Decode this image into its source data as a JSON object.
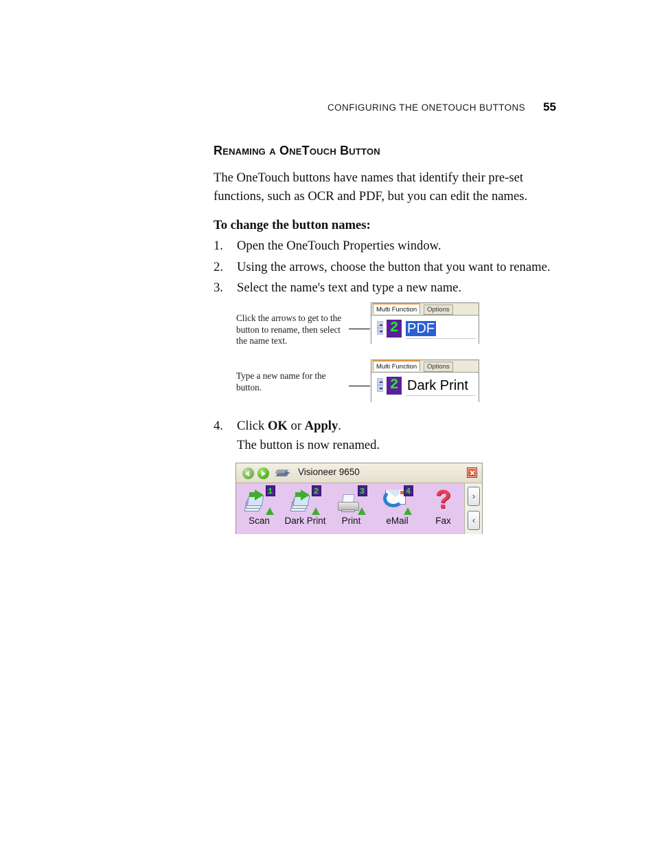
{
  "header": {
    "title": "Configuring the OneTouch Buttons",
    "page_number": "55"
  },
  "section": {
    "heading": "Renaming a OneTouch Button",
    "intro": "The OneTouch buttons have names that identify their pre-set functions, such as OCR and PDF, but you can edit the names.",
    "lead_in": "To change the button names:"
  },
  "steps": [
    {
      "num": "1.",
      "text": "Open the OneTouch Properties window."
    },
    {
      "num": "2.",
      "text": "Using the arrows, choose the button that you want to rename."
    },
    {
      "num": "3.",
      "text": "Select the name's text and type a new name."
    },
    {
      "num": "4.",
      "text_before": "Click ",
      "bold_1": "OK",
      "text_middle": " or ",
      "bold_2": "Apply",
      "text_after": "."
    }
  ],
  "step_4_note": "The button is now renamed.",
  "callouts": [
    {
      "text": "Click the arrows to get to the button to rename, then select the name text."
    },
    {
      "text": "Type a new name for the button."
    }
  ],
  "dialogs": [
    {
      "tab_active": "Multi Function",
      "tab_inactive": "Options",
      "button_number": "2",
      "name_value": "PDF",
      "name_selected": true
    },
    {
      "tab_active": "Multi Function",
      "tab_inactive": "Options",
      "button_number": "2",
      "name_value": "Dark Print",
      "name_selected": false
    }
  ],
  "onetouch_panel": {
    "title": "Visioneer 9650",
    "back_icon": "back-arrow-icon",
    "forward_icon": "forward-arrow-icon",
    "device_icon": "scanner-icon",
    "close_icon": "close-icon",
    "buttons": [
      {
        "label": "Scan",
        "badge": "1",
        "icon": "scan-icon"
      },
      {
        "label": "Dark Print",
        "badge": "2",
        "icon": "scan-icon"
      },
      {
        "label": "Print",
        "badge": "3",
        "icon": "printer-icon"
      },
      {
        "label": "eMail",
        "badge": "4",
        "icon": "email-icon"
      },
      {
        "label": "Fax",
        "badge": "",
        "icon": "question-mark-icon"
      }
    ],
    "scroll_next": "›",
    "scroll_prev": "‹"
  },
  "colors": {
    "accent_orange": "#f0a13c",
    "panel_purple": "#e5c6ef",
    "badge_purple": "#4b1f8a",
    "badge_green": "#25e825",
    "selection_blue": "#2a5fd4",
    "close_red": "#cf3a20"
  }
}
